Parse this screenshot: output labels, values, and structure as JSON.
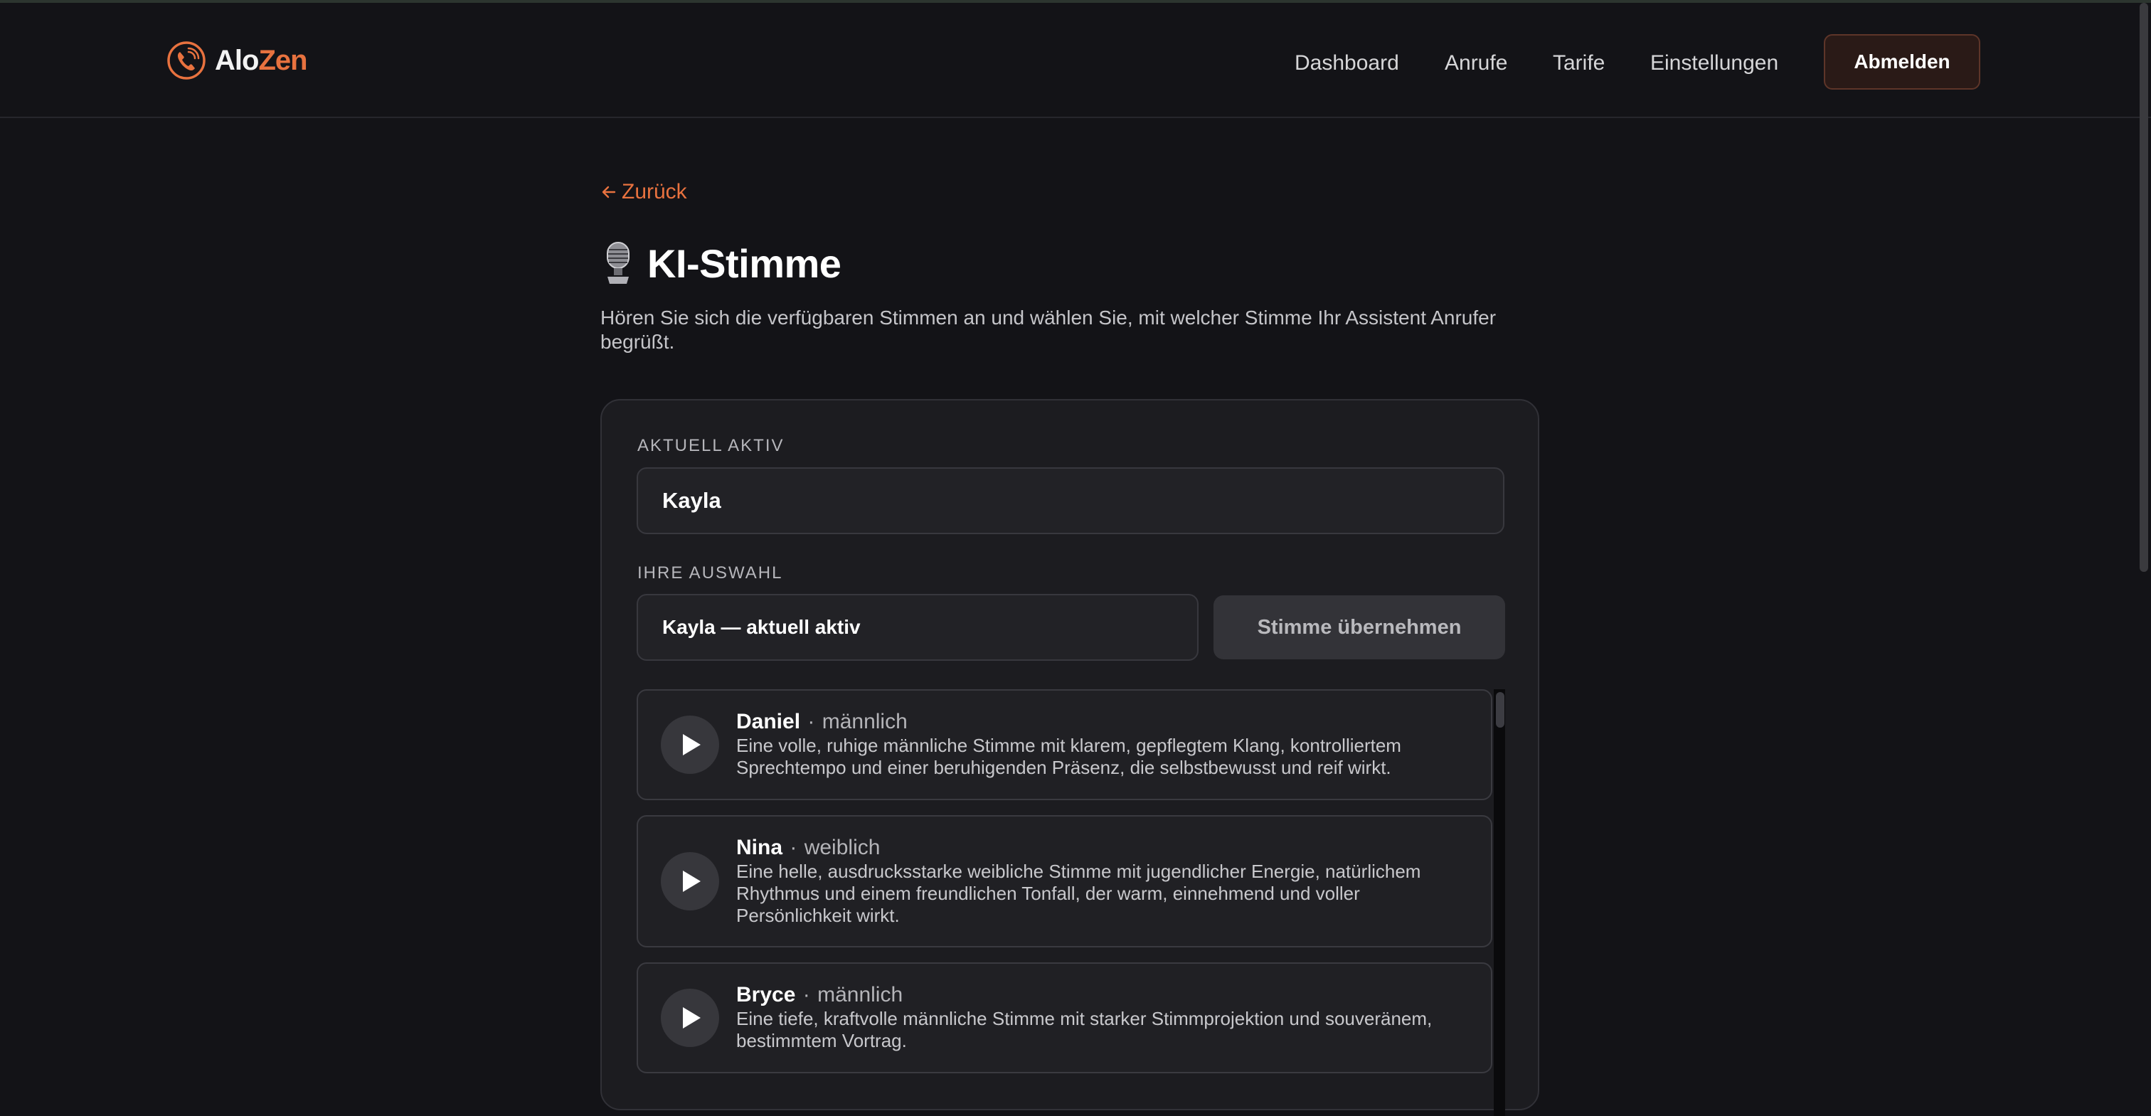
{
  "header": {
    "logo": {
      "part1": "Alo",
      "part2": "Zen",
      "icon": "phone-icon"
    },
    "nav": [
      {
        "label": "Dashboard"
      },
      {
        "label": "Anrufe"
      },
      {
        "label": "Tarife"
      },
      {
        "label": "Einstellungen"
      }
    ],
    "logout_label": "Abmelden"
  },
  "main": {
    "back_label": "Zurück",
    "back_icon": "arrow-left-icon",
    "title_icon": "microphone-icon",
    "title": "KI-Stimme",
    "subtitle": "Hören Sie sich die verfügbaren Stimmen an und wählen Sie, mit welcher Stimme Ihr Assistent Anrufer begrüßt."
  },
  "card": {
    "active_label": "AKTUELL AKTIV",
    "active_value": "Kayla",
    "selection_label": "IHRE AUSWAHL",
    "selection_value": "Kayla — aktuell aktiv",
    "apply_label": "Stimme übernehmen",
    "voices": [
      {
        "name": "Daniel",
        "separator": "·",
        "gender": "männlich",
        "description": "Eine volle, ruhige männliche Stimme mit klarem, gepflegtem Klang, kontrolliertem Sprechtempo und einer beruhigenden Präsenz, die selbstbewusst und reif wirkt."
      },
      {
        "name": "Nina",
        "separator": "·",
        "gender": "weiblich",
        "description": "Eine helle, ausdrucksstarke weibliche Stimme mit jugendlicher Energie, natürlichem Rhythmus und einem freundlichen Tonfall, der warm, einnehmend und voller Persönlichkeit wirkt."
      },
      {
        "name": "Bryce",
        "separator": "·",
        "gender": "männlich",
        "description": "Eine tiefe, kraftvolle männliche Stimme mit starker Stimmprojektion und souveränem, bestimmtem Vortrag."
      }
    ]
  },
  "colors": {
    "accent": "#e8723f",
    "background": "#131317",
    "card": "#1c1c20",
    "text": "#ececec"
  }
}
